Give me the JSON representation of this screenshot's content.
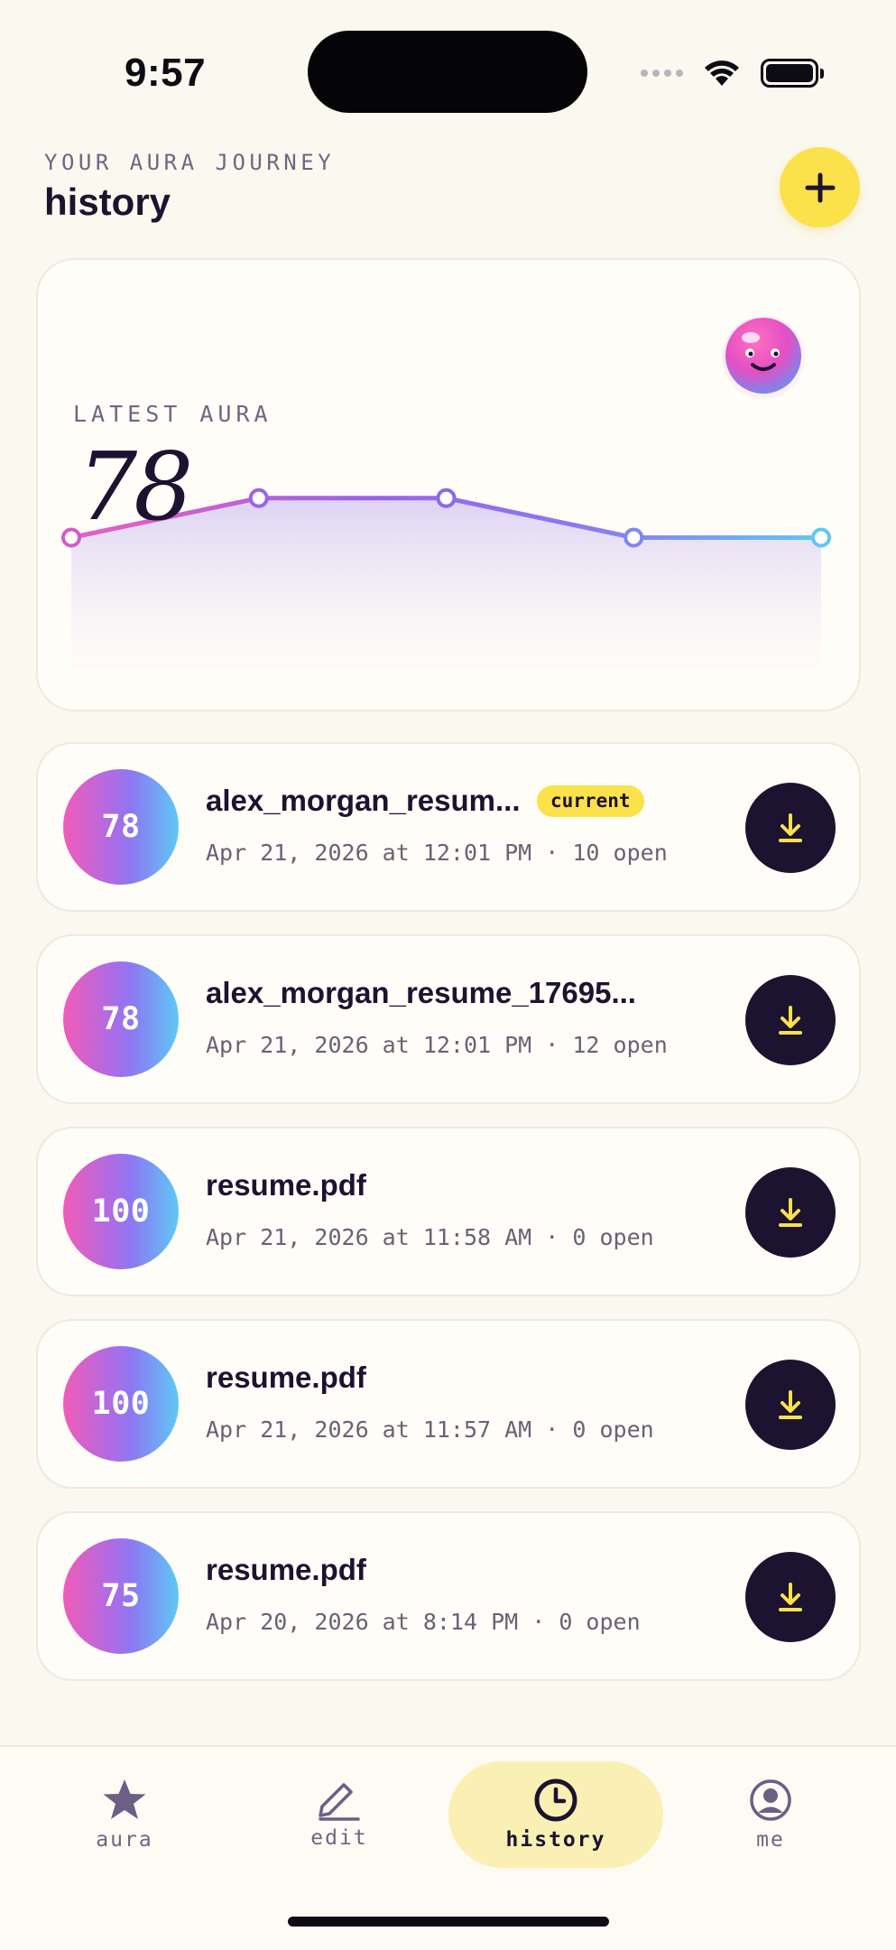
{
  "status_bar": {
    "time": "9:57"
  },
  "header": {
    "eyebrow": "YOUR AURA JOURNEY",
    "title": "history"
  },
  "aura_card": {
    "label": "LATEST AURA",
    "value": "78"
  },
  "chart_data": {
    "type": "line",
    "values": [
      78,
      85,
      85,
      78,
      78
    ],
    "gradient_colors": [
      "#ea5fc3",
      "#9a63e8",
      "#8a7bf2",
      "#5fc8f3"
    ]
  },
  "history": [
    {
      "score": "100"
    },
    {
      "score": "78",
      "file": "alex_morgan_resum...",
      "badge": "current",
      "meta": "Apr 21, 2026 at 12:01 PM · 10 open"
    },
    {
      "score": "78",
      "file": "alex_morgan_resume_17695...",
      "meta": "Apr 21, 2026 at 12:01 PM · 12 open"
    },
    {
      "score": "100",
      "file": "resume.pdf",
      "meta": "Apr 21, 2026 at 11:58 AM · 0 open"
    },
    {
      "score": "100",
      "file": "resume.pdf",
      "meta": "Apr 21, 2026 at 11:57 AM · 0 open"
    },
    {
      "score": "75",
      "file": "resume.pdf",
      "meta": "Apr 20, 2026 at 8:14 PM · 0 open"
    }
  ],
  "tabs": [
    {
      "label": "aura",
      "icon": "star-icon"
    },
    {
      "label": "edit",
      "icon": "pencil-icon"
    },
    {
      "label": "history",
      "icon": "clock-icon",
      "active": true
    },
    {
      "label": "me",
      "icon": "user-circle-icon"
    }
  ],
  "colors": {
    "accent": "#fbe14a",
    "ink": "#1c1330",
    "background": "#fbf8ef"
  }
}
